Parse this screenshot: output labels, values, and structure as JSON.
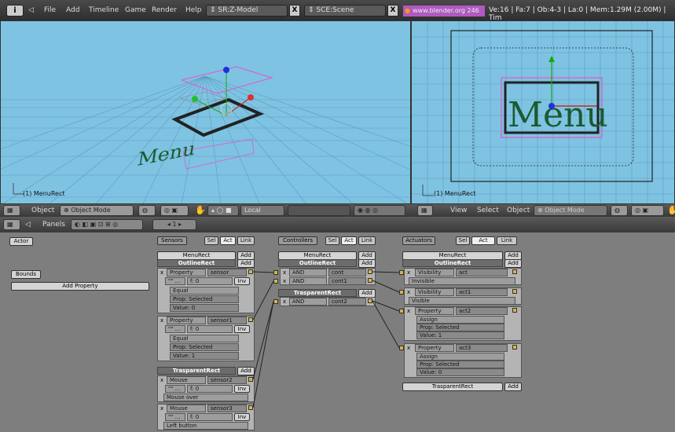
{
  "topbar": {
    "menu": [
      "File",
      "Add",
      "Timeline",
      "Game",
      "Render",
      "Help"
    ],
    "screen_field": "SR:Z-Model",
    "scene_field": "SCE:Scene",
    "url": "www.blender.org 246",
    "stats": "Ve:16 | Fa:7 | Ob:4-3 | La:0 | Mem:1.29M (2.00M) | Tim"
  },
  "viewport_left": {
    "label": "(1) MenuRect",
    "menu_text": "Menu"
  },
  "viewport_right": {
    "label": "(1) MenuRect",
    "menu_text": "Menu"
  },
  "view3d_header_left": {
    "object_label": "Object",
    "mode": "Object Mode",
    "orientation": "Local"
  },
  "view3d_header_right": {
    "menu": [
      "View",
      "Select",
      "Object"
    ],
    "mode": "Object Mode"
  },
  "buttons_header": {
    "panels_label": "Panels",
    "frame": "1"
  },
  "logic": {
    "actor_label": "Actor",
    "bounds_label": "Bounds",
    "add_property_label": "Add Property",
    "sensors_title": "Sensors",
    "controllers_title": "Controllers",
    "actuators_title": "Actuators",
    "tab_sel": "Sel",
    "tab_act": "Act",
    "tab_link": "Link",
    "add": "Add",
    "sensors": {
      "obj1": "MenuRect",
      "obj1b": "OutlineRect",
      "s0_type": "Property",
      "s0_name": "sensor",
      "s0_f": "f: 0",
      "s0_inv": "Inv",
      "s0_mode": "Equal",
      "s0_prop": "Prop: Selected",
      "s0_value": "Value: 0",
      "s1_type": "Property",
      "s1_name": "sensor1",
      "s1_f": "f: 0",
      "s1_inv": "Inv",
      "s1_mode": "Equal",
      "s1_prop": "Prop: Selected",
      "s1_value": "Value: 1",
      "obj2": "TrasparentRect",
      "s2_type": "Mouse",
      "s2_name": "sensor2",
      "s2_f": "f: 0",
      "s2_inv": "Inv",
      "s2_mode": "Mouse over",
      "s3_type": "Mouse",
      "s3_name": "sensor3",
      "s3_f": "f: 0",
      "s3_inv": "Inv",
      "s3_mode": "Left button"
    },
    "controllers": {
      "obj1": "MenuRect",
      "obj1b": "OutlineRect",
      "c0_type": "AND",
      "c0_name": "cont",
      "c1_type": "AND",
      "c1_name": "cont1",
      "obj2": "TrasparentRect",
      "c2_type": "AND",
      "c2_name": "cont2"
    },
    "actuators": {
      "obj1": "MenuRect",
      "obj1b": "OutlineRect",
      "a0_type": "Visibility",
      "a0_name": "act",
      "a0_mode": "Invisible",
      "a1_type": "Visibility",
      "a1_name": "act1",
      "a1_mode": "Visible",
      "a2_type": "Property",
      "a2_name": "act2",
      "a2_mode": "Assign",
      "a2_prop": "Prop: Selected",
      "a2_value": "Value: 1",
      "a3_type": "Property",
      "a3_name": "act3",
      "a3_mode": "Assign",
      "a3_prop": "Prop: Selected",
      "a3_value": "Value: 0",
      "obj2": "TrasparentRect"
    }
  }
}
